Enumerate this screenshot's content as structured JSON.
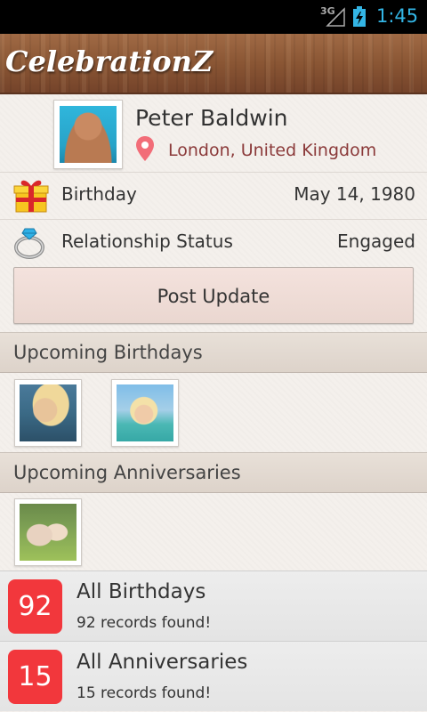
{
  "status_bar": {
    "network": "3G",
    "time": "1:45",
    "icons": [
      "signal-icon",
      "battery-charging-icon"
    ]
  },
  "app_bar": {
    "title": "CelebrationZ"
  },
  "profile": {
    "name": "Peter Baldwin",
    "location": "London, United Kingdom",
    "photo": "profile-photo"
  },
  "details": [
    {
      "icon": "gift-icon",
      "label": "Birthday",
      "value": "May 14, 1980"
    },
    {
      "icon": "ring-icon",
      "label": "Relationship Status",
      "value": "Engaged"
    }
  ],
  "post_button": {
    "label": "Post Update"
  },
  "sections": {
    "birthdays": {
      "title": "Upcoming Birthdays",
      "thumbs": [
        "birthday-thumb-1",
        "birthday-thumb-2"
      ]
    },
    "anniversaries": {
      "title": "Upcoming Anniversaries",
      "thumbs": [
        "anniversary-thumb-1"
      ]
    }
  },
  "summaries": [
    {
      "count": "92",
      "title": "All Birthdays",
      "subtitle": "92 records found!"
    },
    {
      "count": "15",
      "title": "All Anniversaries",
      "subtitle": "15 records found!"
    }
  ],
  "colors": {
    "badge": "#f2373c",
    "location": "#8b3a3a",
    "status_accent": "#33b5e5"
  }
}
